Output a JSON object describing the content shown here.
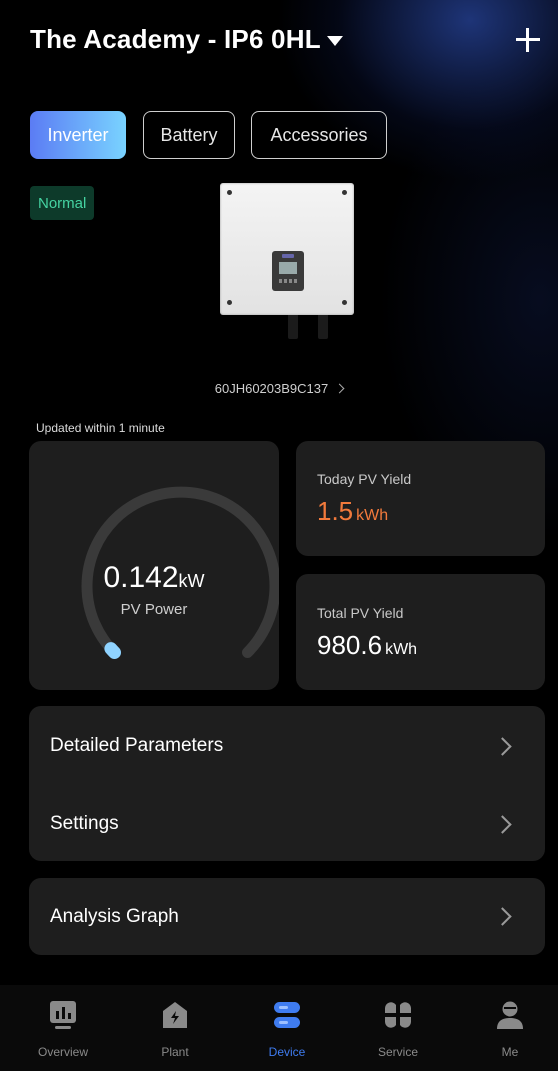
{
  "header": {
    "title": "The Academy - IP6 0HL"
  },
  "tabs": [
    {
      "label": "Inverter",
      "active": true
    },
    {
      "label": "Battery",
      "active": false
    },
    {
      "label": "Accessories",
      "active": false
    }
  ],
  "device": {
    "status": "Normal",
    "serial": "60JH60203B9C137",
    "updated": "Updated  within 1 minute"
  },
  "pv_power": {
    "value": "0.142",
    "unit": "kW",
    "label": "PV Power",
    "gauge_fraction": 0.01
  },
  "today_yield": {
    "label": "Today PV Yield",
    "value": "1.5",
    "unit": "kWh"
  },
  "total_yield": {
    "label": "Total PV Yield",
    "value": "980.6",
    "unit": "kWh"
  },
  "menu": {
    "detailed": "Detailed Parameters",
    "settings": "Settings",
    "analysis": "Analysis Graph"
  },
  "nav": [
    {
      "label": "Overview",
      "icon": "overview-icon"
    },
    {
      "label": "Plant",
      "icon": "plant-icon"
    },
    {
      "label": "Device",
      "icon": "device-icon",
      "active": true
    },
    {
      "label": "Service",
      "icon": "service-icon"
    },
    {
      "label": "Me",
      "icon": "me-icon"
    }
  ],
  "colors": {
    "accent": "#3f7cf0",
    "status_green": "#45d3a2",
    "yield_orange": "#f27a3c",
    "gauge_blue": "#8fd3ff"
  }
}
